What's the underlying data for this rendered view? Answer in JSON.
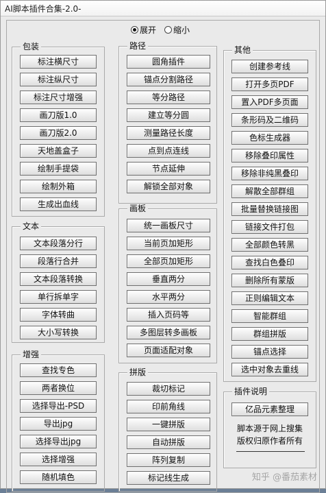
{
  "window": {
    "title": "AI脚本插件合集-2.0-"
  },
  "view_mode": {
    "expand_label": "展开",
    "collapse_label": "缩小",
    "selected": "展开"
  },
  "panels": {
    "packaging": {
      "title": "包装",
      "buttons": [
        "标注横尺寸",
        "标注纵尺寸",
        "标注尺寸增强",
        "画刀版1.0",
        "画刀版2.0",
        "天地盖盒子",
        "绘制手提袋",
        "绘制外箱",
        "生成出血线"
      ]
    },
    "text": {
      "title": "文本",
      "buttons": [
        "文本段落分行",
        "段落行合并",
        "文本段落转换",
        "单行拆单字",
        "字体转曲",
        "大小写转换"
      ]
    },
    "enhance": {
      "title": "增强",
      "buttons": [
        "查找专色",
        "两者换位",
        "选择导出-PSD",
        "导出jpg",
        "选择导出jpg",
        "选择增强",
        "随机填色"
      ]
    },
    "path": {
      "title": "路径",
      "buttons": [
        "圆角插件",
        "锚点分割路径",
        "等分路径",
        "建立等分圆",
        "测量路径长度",
        "点到点连线",
        "节点延伸",
        "解锁全部对象"
      ]
    },
    "artboard": {
      "title": "画板",
      "buttons": [
        "统一画板尺寸",
        "当前页加矩形",
        "全部页加矩形",
        "垂直两分",
        "水平两分",
        "插入页码等",
        "多图层转多画板",
        "页面适配对象"
      ]
    },
    "imposition": {
      "title": "拼版",
      "buttons": [
        "裁切标记",
        "印前角线",
        "一键拼版",
        "自动拼版",
        "阵列复制",
        "标记线生成"
      ]
    },
    "other": {
      "title": "其他",
      "buttons": [
        "创建参考线",
        "打开多页PDF",
        "置入PDF多页面",
        "条形码及二维码",
        "色标生成器",
        "移除叠印属性",
        "移除非纯黑叠印",
        "解散全部群组",
        "批量替换链接图",
        "链接文件打包",
        "全部颜色转黑",
        "查找白色叠印",
        "删除所有蒙版",
        "正则编辑文本",
        "智能群组",
        "群组拼版",
        "锚点选择",
        "选中对象去重线"
      ]
    },
    "plugin_info": {
      "title": "插件说明",
      "button": "亿品元素整理",
      "line1": "脚本源于网上搜集",
      "line2": "版权归原作者所有"
    }
  },
  "watermark": "知乎 @番茄素材"
}
